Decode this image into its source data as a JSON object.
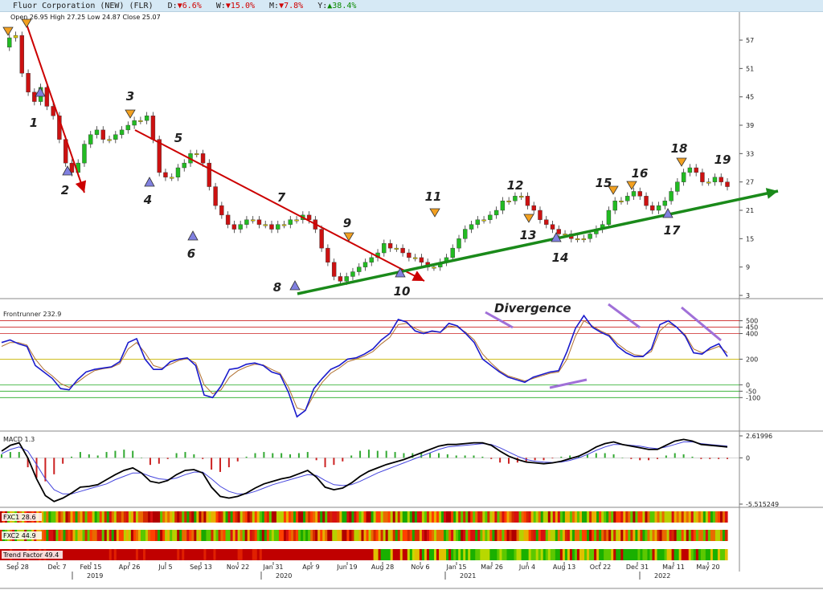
{
  "header": {
    "title": "Fluor Corporation (NEW) (FLR)",
    "d_label": "D:",
    "d_value": "▼6.6%",
    "w_label": "W:",
    "w_value": "▼15.0%",
    "m_label": "M:",
    "m_value": "▼7.8%",
    "y_label": "Y:",
    "y_value": "▲38.4%"
  },
  "ohlc": {
    "text": "Open 26.95  High 27.25  Low 24.87  Close 25.07"
  },
  "chart_data": [
    {
      "type": "candlestick",
      "name": "price",
      "y_ticks": [
        "57",
        "51",
        "45",
        "39",
        "33",
        "27",
        "21",
        "15",
        "9",
        "3"
      ],
      "ylim": [
        3,
        57
      ],
      "x_ticks": [
        "Sep 28",
        "Dec 7",
        "Feb 15",
        "Apr 26",
        "Jul 5",
        "Sep 13",
        "Nov 22",
        "Jan 31",
        "Apr 9",
        "Jun 19",
        "Aug 28",
        "Nov 6",
        "Jan 15",
        "Mar 26",
        "Jun 4",
        "Aug 13",
        "Oct 22",
        "Dec 31",
        "Mar 11",
        "May 20"
      ],
      "year_labels": [
        "2019",
        "2020",
        "2021",
        "2022"
      ],
      "close_path": [
        55.5,
        57.5,
        58,
        50,
        46,
        44,
        47,
        43,
        41,
        36,
        31,
        29,
        31,
        35,
        37,
        38,
        36,
        36,
        37,
        38,
        39,
        40,
        40,
        41,
        36,
        29,
        28,
        28,
        30,
        31,
        33,
        33,
        31,
        26,
        22,
        20,
        18,
        17,
        18,
        19,
        19,
        18,
        18,
        17,
        18,
        18,
        19,
        19,
        20,
        19,
        17,
        13,
        10,
        7,
        6,
        7,
        8,
        9,
        10,
        11,
        12,
        14,
        13,
        13,
        12,
        11,
        11,
        10,
        9,
        9,
        10,
        11,
        13,
        15,
        17,
        18,
        19,
        19,
        20,
        21,
        23,
        23,
        24,
        24,
        22,
        21,
        19,
        18,
        17,
        16,
        16,
        15,
        15,
        15,
        16,
        17,
        18,
        21,
        23,
        23,
        24,
        25,
        24,
        22,
        21,
        22,
        23,
        25,
        27,
        29,
        30,
        29,
        27,
        27,
        28,
        27,
        26
      ],
      "annotations": [
        "1",
        "2",
        "3",
        "4",
        "5",
        "6",
        "7",
        "8",
        "9",
        "10",
        "11",
        "12",
        "13",
        "14",
        "15",
        "16",
        "17",
        "18",
        "19"
      ],
      "trendlines": [
        {
          "color": "#cc0000"
        },
        {
          "color": "#cc0000"
        },
        {
          "color": "#1a8a1a"
        }
      ]
    },
    {
      "type": "line",
      "name": "Frontrunner",
      "label": "Frontrunner 232.9",
      "y_ticks": [
        "500",
        "450",
        "400",
        "200",
        "0",
        "-50",
        "-100"
      ],
      "annotation": "Divergence",
      "series": [
        {
          "color": "#1a1acc",
          "values": [
            330,
            350,
            320,
            300,
            150,
            100,
            50,
            -30,
            -40,
            40,
            100,
            120,
            130,
            140,
            180,
            330,
            360,
            200,
            120,
            120,
            180,
            200,
            210,
            150,
            -80,
            -100,
            -10,
            120,
            130,
            160,
            170,
            150,
            100,
            80,
            -60,
            -250,
            -200,
            -30,
            50,
            120,
            150,
            200,
            210,
            240,
            280,
            350,
            400,
            510,
            490,
            420,
            400,
            420,
            410,
            480,
            460,
            400,
            330,
            200,
            150,
            100,
            60,
            40,
            20,
            60,
            80,
            100,
            110,
            260,
            440,
            540,
            450,
            410,
            380,
            300,
            250,
            220,
            220,
            280,
            470,
            500,
            450,
            380,
            250,
            240,
            290,
            320,
            220
          ]
        },
        {
          "color": "#b07030",
          "values": [
            300,
            330,
            330,
            310,
            200,
            120,
            70,
            10,
            -20,
            20,
            70,
            110,
            125,
            135,
            165,
            280,
            330,
            250,
            150,
            130,
            160,
            190,
            205,
            170,
            0,
            -70,
            -40,
            60,
            110,
            140,
            160,
            155,
            120,
            90,
            -20,
            -180,
            -200,
            -80,
            20,
            90,
            130,
            180,
            200,
            225,
            260,
            320,
            370,
            470,
            480,
            440,
            410,
            415,
            410,
            460,
            450,
            410,
            350,
            240,
            170,
            110,
            70,
            50,
            30,
            50,
            70,
            90,
            100,
            200,
            380,
            500,
            460,
            420,
            390,
            320,
            270,
            235,
            225,
            260,
            420,
            480,
            450,
            390,
            280,
            250,
            275,
            300,
            250
          ]
        }
      ],
      "bands": [
        500,
        450,
        400,
        200,
        0,
        -50,
        -100
      ]
    },
    {
      "type": "line",
      "name": "MACD",
      "label": "MACD 1.3",
      "y_ticks": [
        "2.61996",
        "0",
        "-5.515249"
      ],
      "series": [
        {
          "color": "#000000",
          "values": [
            0.8,
            1.5,
            1.8,
            0,
            -2.5,
            -4.5,
            -5.2,
            -4.8,
            -4.2,
            -3.5,
            -3.4,
            -3.2,
            -2.6,
            -2,
            -1.5,
            -1.2,
            -1.8,
            -2.8,
            -3,
            -2.7,
            -2,
            -1.5,
            -1.4,
            -1.8,
            -3.5,
            -4.6,
            -4.8,
            -4.6,
            -4.2,
            -3.6,
            -3.1,
            -2.8,
            -2.5,
            -2.3,
            -1.9,
            -1.5,
            -2.3,
            -3.5,
            -3.8,
            -3.6,
            -3,
            -2.2,
            -1.6,
            -1.2,
            -0.8,
            -0.5,
            -0.2,
            0.2,
            0.6,
            1,
            1.4,
            1.6,
            1.6,
            1.7,
            1.8,
            1.8,
            1.5,
            0.8,
            0.2,
            -0.2,
            -0.5,
            -0.6,
            -0.7,
            -0.6,
            -0.4,
            -0.1,
            0.2,
            0.7,
            1.3,
            1.7,
            1.9,
            1.6,
            1.4,
            1.2,
            1,
            1,
            1.5,
            2,
            2.2,
            2,
            1.6,
            1.5,
            1.4,
            1.3
          ]
        },
        {
          "color": "#4444dd",
          "values": [
            0.5,
            1,
            1.3,
            0.8,
            -0.8,
            -2.5,
            -3.8,
            -4.3,
            -4.3,
            -4,
            -3.7,
            -3.4,
            -3.1,
            -2.6,
            -2.2,
            -1.8,
            -1.8,
            -2.2,
            -2.5,
            -2.6,
            -2.4,
            -2,
            -1.7,
            -1.7,
            -2.5,
            -3.4,
            -4,
            -4.3,
            -4.3,
            -4,
            -3.6,
            -3.2,
            -2.9,
            -2.6,
            -2.3,
            -2,
            -2.1,
            -2.7,
            -3.2,
            -3.3,
            -3.2,
            -2.8,
            -2.3,
            -1.8,
            -1.4,
            -1,
            -0.6,
            -0.2,
            0.2,
            0.6,
            1,
            1.3,
            1.4,
            1.5,
            1.6,
            1.7,
            1.6,
            1.2,
            0.7,
            0.2,
            -0.2,
            -0.4,
            -0.5,
            -0.55,
            -0.5,
            -0.3,
            0,
            0.4,
            0.9,
            1.3,
            1.6,
            1.6,
            1.5,
            1.4,
            1.2,
            1.1,
            1.3,
            1.6,
            1.9,
            1.9,
            1.7,
            1.6,
            1.5,
            1.4
          ]
        }
      ]
    },
    {
      "type": "heatmap",
      "name": "FXC1",
      "label": "FXC1 28.6"
    },
    {
      "type": "heatmap",
      "name": "FXC2",
      "label": "FXC2 44.9"
    },
    {
      "type": "heatmap",
      "name": "Trend Factor",
      "label": "Trend Factor 49.4"
    }
  ]
}
